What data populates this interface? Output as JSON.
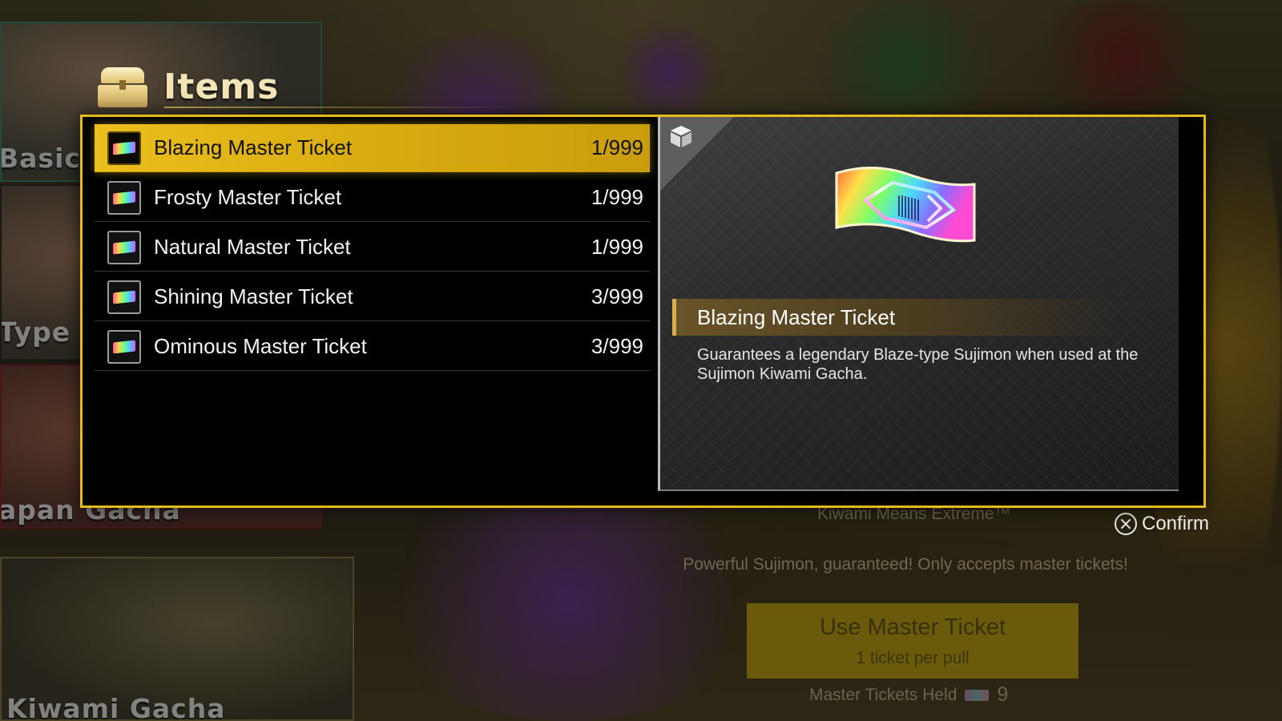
{
  "header": {
    "title": "Items"
  },
  "items": [
    {
      "name": "Blazing Master Ticket",
      "count": "1/999",
      "selected": true
    },
    {
      "name": "Frosty Master Ticket",
      "count": "1/999",
      "selected": false
    },
    {
      "name": "Natural Master Ticket",
      "count": "1/999",
      "selected": false
    },
    {
      "name": "Shining Master Ticket",
      "count": "3/999",
      "selected": false
    },
    {
      "name": "Ominous Master Ticket",
      "count": "3/999",
      "selected": false
    }
  ],
  "detail": {
    "title": "Blazing Master Ticket",
    "description": "Guarantees a legendary Blaze-type Sujimon when used at the Sujimon Kiwami Gacha.",
    "icon": "rainbow-ticket-icon"
  },
  "prompt": {
    "confirm_label": "Confirm",
    "button_icon": "cross-button-icon"
  },
  "background": {
    "banners": [
      {
        "label": "Basic G"
      },
      {
        "label": "Type G"
      },
      {
        "label": "apan Gacha"
      },
      {
        "label": "Kiwami Gacha"
      }
    ],
    "gacha_subtitle": "Kiwami Means Extreme™",
    "gacha_description": "Powerful Sujimon, guaranteed! Only accepts master tickets!",
    "use_ticket_button": {
      "label": "Use Master Ticket",
      "sublabel": "1 ticket per pull"
    },
    "tickets_held_label": "Master Tickets Held",
    "tickets_held_count": "9"
  },
  "colors": {
    "panel_border": "#e5bb1a",
    "selected_row": "#ebbf1c",
    "title_accent": "#d9b048"
  }
}
